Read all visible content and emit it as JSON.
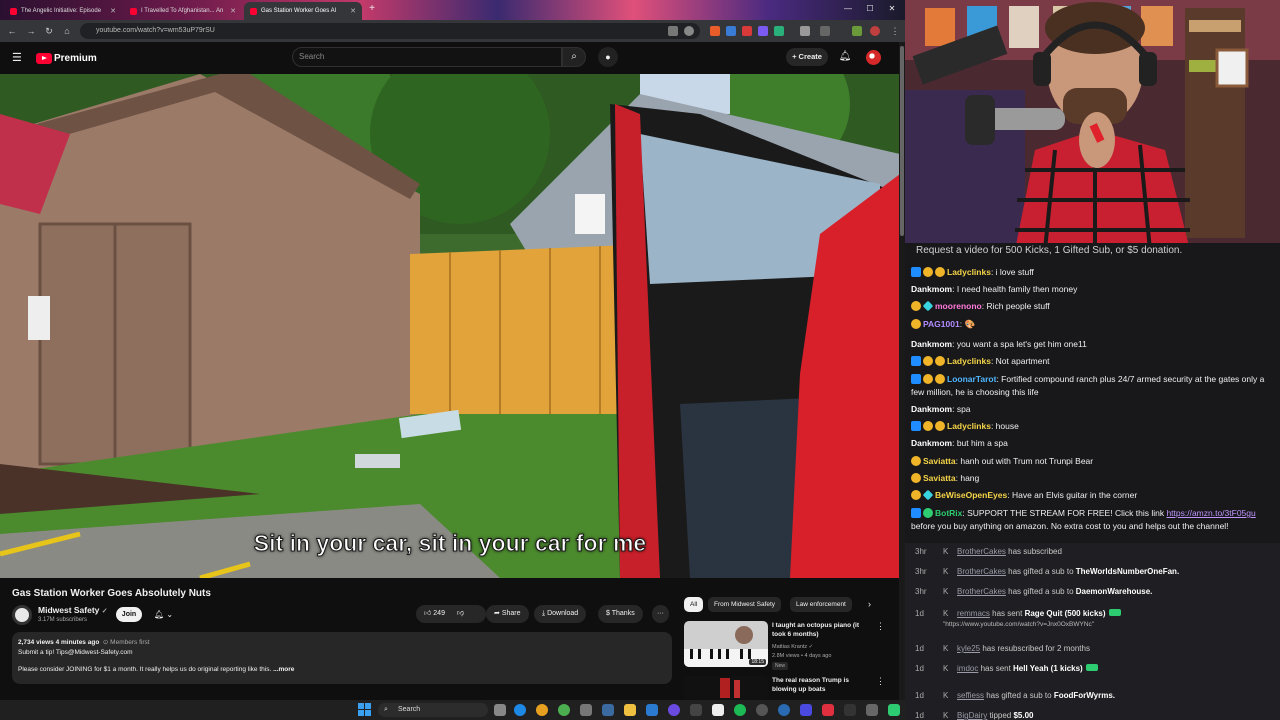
{
  "browser": {
    "tabs": [
      {
        "label": "The Angelic Initiative: Episode"
      },
      {
        "label": "I Travelled To Afghanistan... An"
      },
      {
        "label": "Gas Station Worker Goes Al"
      }
    ],
    "new_tab": "+",
    "url": "youtube.com/watch?v=wm53uP79rSU",
    "window": {
      "minimize": "—",
      "maximize": "☐",
      "close": "✕"
    }
  },
  "youtube": {
    "logo_text": "Premium",
    "search_placeholder": "Search",
    "create_label": "+ Create",
    "subtitle": "Sit in your car, sit in your car for me",
    "video_title": "Gas Station Worker Goes Absolutely Nuts",
    "channel": {
      "name": "Midwest Safety",
      "subscribers": "3.17M subscribers",
      "join": "Join"
    },
    "actions": {
      "likes": "249",
      "share": "Share",
      "download": "Download",
      "thanks": "Thanks",
      "more": "···"
    },
    "description": {
      "meta": "2,734 views  4 minutes ago",
      "members_first": "⊙ Members first",
      "line1": "Submit a tip! Tips@Midwest-Safety.com",
      "line2": "Please consider JOINING for $1 a month. It really helps us do original reporting like this.",
      "more": "...more"
    },
    "chips": [
      {
        "label": "All",
        "selected": true
      },
      {
        "label": "From Midwest Safety",
        "selected": false
      },
      {
        "label": "Law enforcement",
        "selected": false
      }
    ],
    "recommendations": [
      {
        "title": "I taught an octopus piano (it took 6 months)",
        "channel": "Mattias Krantz ✓",
        "stats": "2.8M views • 4 days ago",
        "badge": "New",
        "duration": "18:15"
      },
      {
        "title": "The real reason Trump is blowing up boats",
        "channel": "",
        "stats": "",
        "badge": "",
        "duration": ""
      }
    ]
  },
  "chat": {
    "notice": "Request a video for 500 Kicks, 1 Gifted Sub, or $5 donation.",
    "messages": [
      {
        "user": "Ladyclinks",
        "text": "i love stuff",
        "color": "#f5d547",
        "badges": [
          "blue",
          "gold",
          "gold"
        ]
      },
      {
        "user": "Dankmom",
        "text": "I need health family then money",
        "color": "#ffffff",
        "badges": []
      },
      {
        "user": "moorenono",
        "text": "Rich people stuff",
        "color": "#ff7ad9",
        "badges": [
          "gold",
          "cyan"
        ]
      },
      {
        "user": "PAG1001",
        "text": "🎨",
        "color": "#b28bff",
        "badges": [
          "gold"
        ]
      },
      {
        "user": "Dankmom",
        "text": "you want a spa let's get him one11",
        "color": "#ffffff",
        "badges": []
      },
      {
        "user": "Ladyclinks",
        "text": "Not apartment",
        "color": "#f5d547",
        "badges": [
          "blue",
          "gold",
          "gold"
        ]
      },
      {
        "user": "LoonarTarot",
        "text": "Fortified compound ranch plus 24/7 armed security at the gates only a few million, he is choosing this life",
        "color": "#4fb7ff",
        "badges": [
          "blue",
          "gold",
          "gold"
        ]
      },
      {
        "user": "Dankmom",
        "text": "spa",
        "color": "#ffffff",
        "badges": []
      },
      {
        "user": "Ladyclinks",
        "text": "house",
        "color": "#f5d547",
        "badges": [
          "blue",
          "gold",
          "gold"
        ]
      },
      {
        "user": "Dankmom",
        "text": "but him a spa",
        "color": "#ffffff",
        "badges": []
      },
      {
        "user": "Saviatta",
        "text": "hanh out with Trum not Trunpi Bear",
        "color": "#f5d547",
        "badges": [
          "gold"
        ]
      },
      {
        "user": "Saviatta",
        "text": "hang",
        "color": "#f5d547",
        "badges": [
          "gold"
        ]
      },
      {
        "user": "BeWiseOpenEyes",
        "text": "Have an Elvis guitar in the corner",
        "color": "#f5d547",
        "badges": [
          "gold",
          "cyan"
        ]
      },
      {
        "user": "BotRix",
        "text": "SUPPORT THE STREAM FOR FREE! Click this link ",
        "link": "https://amzn.to/3tF05gu",
        "text2": " before you buy anything on amazon. No extra cost to you and helps out the channel!",
        "color": "#2ecc71",
        "badges": [
          "blue",
          "green"
        ]
      }
    ]
  },
  "events": [
    {
      "time": "3hr",
      "name": "BrotherCakes",
      "action": " has subscribed",
      "target": ""
    },
    {
      "time": "3hr",
      "name": "BrotherCakes",
      "action": " has gifted a sub to ",
      "target": "TheWorldsNumberOneFan."
    },
    {
      "time": "3hr",
      "name": "BrotherCakes",
      "action": " has gifted a sub to ",
      "target": "DaemonWarehouse."
    },
    {
      "time": "1d",
      "name": "remmacs",
      "action": " has sent ",
      "target": "Rage Quit (500 kicks)",
      "sub": "\"https://www.youtube.com/watch?v=Jnx0OxBWYNc\""
    },
    {
      "time": "1d",
      "name": "kyle25",
      "action": " has resubscribed for 2 months",
      "target": ""
    },
    {
      "time": "1d",
      "name": "imdoc",
      "action": " has sent ",
      "target": "Hell Yeah (1 kicks)"
    },
    {
      "time": "1d",
      "name": "seffiess",
      "action": " has gifted a sub to ",
      "target": "FoodForWyrms."
    },
    {
      "time": "1d",
      "name": "BigDairy",
      "action": " tipped ",
      "target": "$5.00"
    }
  ],
  "taskbar": {
    "search_placeholder": "Search"
  },
  "colors": {
    "yt_red": "#ff0033",
    "bg": "#0f0f0f",
    "chat_bg": "#18181b"
  }
}
